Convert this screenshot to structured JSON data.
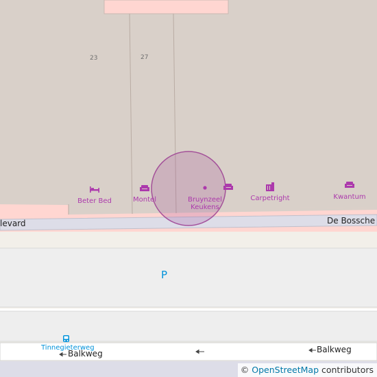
{
  "map": {
    "house_numbers": [
      "23",
      "27"
    ],
    "pois": [
      {
        "name": "Beter Bed",
        "icon": "bed-icon"
      },
      {
        "name": "Montel",
        "icon": "sofa-icon"
      },
      {
        "name": "Bruynzeel\nKeukens",
        "icon": "shop-dot-icon"
      },
      {
        "name": "Carpetright",
        "icon": "carpet-icon"
      },
      {
        "name": "Kwantum",
        "icon": "sofa-icon"
      }
    ],
    "roads": {
      "boulevard_left": "levard",
      "boulevard_right": "De Bossche W",
      "balkweg_left": "Balkweg",
      "balkweg_right": "Balkweg"
    },
    "parking_label": "P",
    "bus_stop": {
      "name": "Tinnegieterweg",
      "icon": "bus-stop-icon"
    },
    "colors": {
      "building": "#d9d0c9",
      "retail": "#ffd6d1",
      "road": "#dddde8",
      "parking": "#eeeeee",
      "poi": "#ac39ac",
      "location_circle": "#9b3d92",
      "bus": "#0092da"
    }
  },
  "attribution": {
    "symbol": "©",
    "link_text": "OpenStreetMap",
    "suffix": "contributors"
  }
}
